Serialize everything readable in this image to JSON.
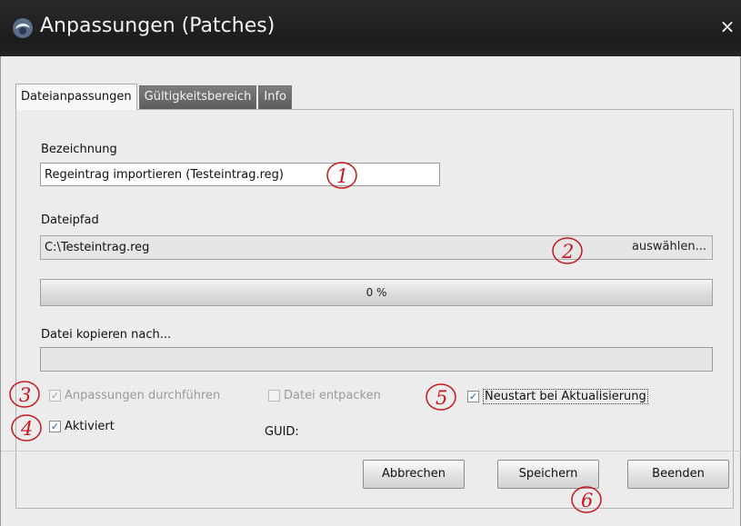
{
  "window": {
    "title": "Anpassungen (Patches)",
    "close_glyph": "×",
    "logo_icon": "app-logo-icon"
  },
  "tabs": [
    {
      "label": "Dateianpassungen",
      "active": true
    },
    {
      "label": "Gültigkeitsbereich",
      "active": false
    },
    {
      "label": "Info",
      "active": false
    }
  ],
  "form": {
    "bezeichnung_label": "Bezeichnung",
    "bezeichnung_value": "Regeintrag importieren (Testeintrag.reg)",
    "dateipfad_label": "Dateipfad",
    "dateipfad_value": "C:\\Testeintrag.reg",
    "auswaehlen_label": "auswählen...",
    "progress_text": "0 %",
    "progress_value": 0,
    "kopieren_label": "Datei kopieren nach...",
    "kopieren_value": ""
  },
  "checkboxes": {
    "anpassungen": {
      "label": "Anpassungen durchführen",
      "checked": true,
      "enabled": false
    },
    "entpacken": {
      "label": "Datei entpacken",
      "checked": false,
      "enabled": false
    },
    "neustart": {
      "label": "Neustart bei Aktualisierung",
      "checked": true,
      "enabled": true
    },
    "aktiviert": {
      "label": "Aktiviert",
      "checked": true,
      "enabled": true
    }
  },
  "guid_label": "GUID:",
  "buttons": {
    "abbrechen": "Abbrechen",
    "speichern": "Speichern",
    "beenden": "Beenden"
  },
  "annotations": [
    "1",
    "2",
    "3",
    "4",
    "5",
    "6"
  ],
  "colors": {
    "annotation_red": "#c8171c",
    "titlebar": "#1f1f1f",
    "check_blue": "#1f5fb0"
  }
}
